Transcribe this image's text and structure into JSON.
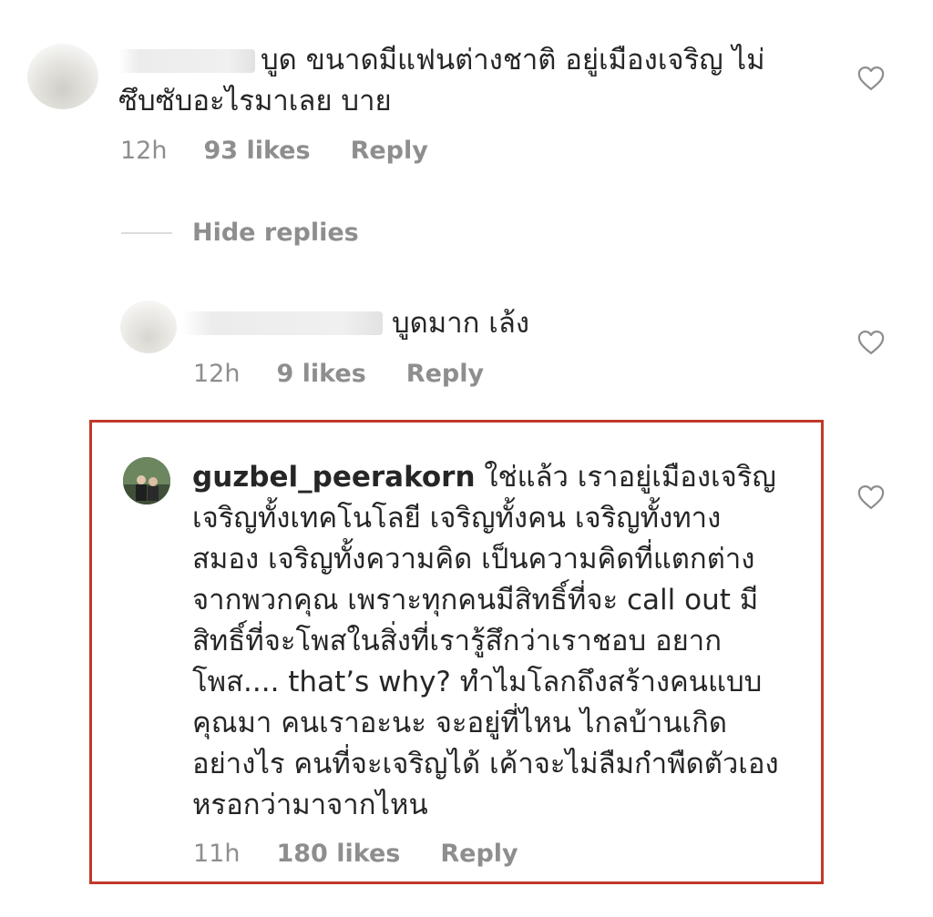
{
  "colors": {
    "text": "#262626",
    "meta": "#8e8e8e",
    "highlight": "#c0392b",
    "divider": "#dbdbdb"
  },
  "comments": [
    {
      "username": "",
      "text": "บูด ขนาดมีแฟนต่างชาติ อยู่เมืองเจริญ ไม่\nซึบซับอะไรมาเลย บาย",
      "time": "12h",
      "likes": "93 likes",
      "reply": "Reply",
      "icon": "heart-outline-icon"
    },
    {
      "username": "",
      "text": "บูดมาก เล้ง",
      "time": "12h",
      "likes": "9 likes",
      "reply": "Reply",
      "icon": "heart-outline-icon"
    },
    {
      "username": "guzbel_peerakorn",
      "text": "ใช่แล้ว เราอยู่เมืองเจริญ",
      "text_rest": "เจริญทั้งเทคโนโลยี เจริญทั้งคน เจริญทั้งทาง\nสมอง เจริญทั้งความคิด เป็นความคิดที่แตกต่าง\nจากพวกคุณ เพราะทุกคนมีสิทธิ์ที่จะ call out มี\nสิทธิ์ที่จะโพสในสิ่งที่เรารู้สึกว่าเราชอบ อยาก\nโพส.... that’s why? ทำไมโลกถึงสร้างคนแบบ\nคุณมา คนเราอะนะ จะอยู่ที่ไหน ไกลบ้านเกิด\nอย่างไร คนที่จะเจริญได้ เค้าจะไม่ลืมกำพืดตัวเอง\nหรอกว่ามาจากไหน",
      "time": "11h",
      "likes": "180 likes",
      "reply": "Reply",
      "icon": "heart-outline-icon"
    }
  ],
  "hide_replies": "Hide replies"
}
